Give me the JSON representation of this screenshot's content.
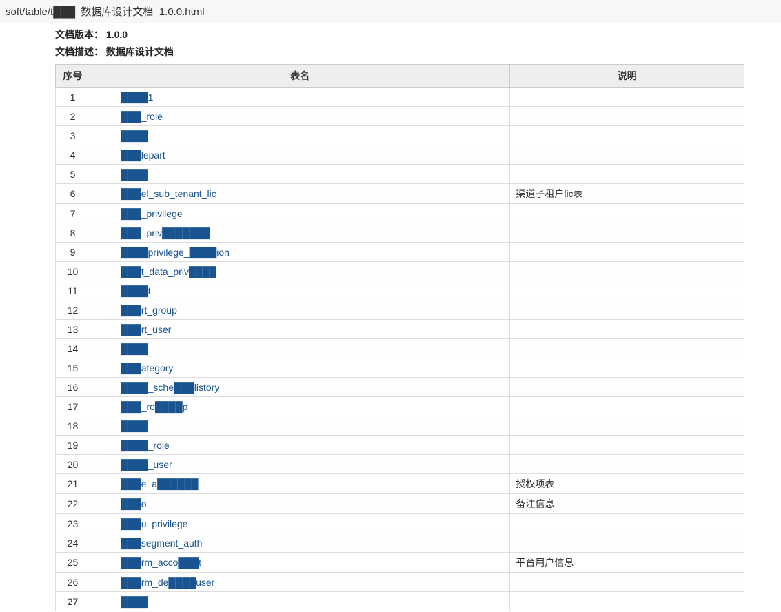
{
  "address_bar": "soft/table/t███_数据库设计文档_1.0.0.html",
  "meta": {
    "version_label": "文档版本：",
    "version_value": "1.0.0",
    "desc_label": "文档描述：",
    "desc_value": "数据库设计文档"
  },
  "headers": {
    "seq": "序号",
    "name": "表名",
    "desc": "说明"
  },
  "rows": [
    {
      "seq": "1",
      "name": "████1",
      "desc": ""
    },
    {
      "seq": "2",
      "name": "███_role",
      "desc": ""
    },
    {
      "seq": "3",
      "name": "████",
      "desc": ""
    },
    {
      "seq": "4",
      "name": "███lepart",
      "desc": ""
    },
    {
      "seq": "5",
      "name": "████",
      "desc": ""
    },
    {
      "seq": "6",
      "name": "███el_sub_tenant_lic",
      "desc": "渠道子租户lic表"
    },
    {
      "seq": "7",
      "name": "███_privilege",
      "desc": ""
    },
    {
      "seq": "8",
      "name": "███_priv███████",
      "desc": ""
    },
    {
      "seq": "9",
      "name": "████privilege_████ion",
      "desc": ""
    },
    {
      "seq": "10",
      "name": "███t_data_priv████",
      "desc": ""
    },
    {
      "seq": "11",
      "name": "████t",
      "desc": ""
    },
    {
      "seq": "12",
      "name": "███rt_group",
      "desc": ""
    },
    {
      "seq": "13",
      "name": "███rt_user",
      "desc": ""
    },
    {
      "seq": "14",
      "name": "████",
      "desc": ""
    },
    {
      "seq": "15",
      "name": "███ategory",
      "desc": ""
    },
    {
      "seq": "16",
      "name": "████_sche███listory",
      "desc": ""
    },
    {
      "seq": "17",
      "name": "███_ro████p",
      "desc": ""
    },
    {
      "seq": "18",
      "name": "████",
      "desc": ""
    },
    {
      "seq": "19",
      "name": "████_role",
      "desc": ""
    },
    {
      "seq": "20",
      "name": "████_user",
      "desc": ""
    },
    {
      "seq": "21",
      "name": "███e_a██████",
      "desc": "授权项表"
    },
    {
      "seq": "22",
      "name": "███o",
      "desc": "备注信息"
    },
    {
      "seq": "23",
      "name": "███u_privilege",
      "desc": ""
    },
    {
      "seq": "24",
      "name": "███segment_auth",
      "desc": ""
    },
    {
      "seq": "25",
      "name": "███rm_acco███t",
      "desc": "平台用户信息"
    },
    {
      "seq": "26",
      "name": "███rm_de████user",
      "desc": ""
    },
    {
      "seq": "27",
      "name": "████",
      "desc": ""
    }
  ]
}
